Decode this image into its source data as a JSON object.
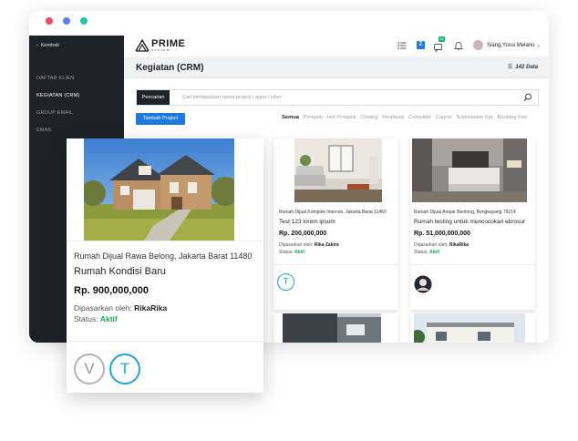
{
  "sidebar": {
    "back_label": "Kembali",
    "items": [
      {
        "label": "DAFTAR KLIEN"
      },
      {
        "label": "KEGIATAN (CRM)"
      },
      {
        "label": "GROUP EMAIL"
      },
      {
        "label": "EMAIL"
      }
    ]
  },
  "header": {
    "logo_text": "PRIME",
    "logo_sub": "SYSTEM",
    "badge_z": "Z",
    "badge_count": "61",
    "user_name": "Siang,Yossi Melano"
  },
  "page": {
    "title": "Kegiatan (CRM)",
    "data_count": "142 Data"
  },
  "search": {
    "button": "Pencarian",
    "placeholder": "Cari berdasarkan nama project / agen / klien"
  },
  "toolbar": {
    "add_button": "Tambah Project",
    "filters": [
      "Semua",
      "Prospek",
      "Hot Prospek",
      "Closing",
      "Finalisasi",
      "Complete",
      "Cancel",
      "Submission Kpr",
      "Booking Fee"
    ]
  },
  "cards": [
    {
      "location": "Rumah Dijual Rawa Belong, Jakarta Barat 11480",
      "title": "Rumah Kondisi Baru",
      "price": "Rp. 900,000,000",
      "by_label": "Dipasarkan oleh:",
      "by_name": "RikaRika",
      "status_label": "Status:",
      "status_value": "Aktif",
      "avatars": [
        "V",
        "T"
      ]
    },
    {
      "location": "Rumah Dijual Komplek Intercon, Jakarta Barat 11460",
      "title": "Test 123 lorem ipsum",
      "price": "Rp. 200,000,000",
      "by_label": "Dipasarkan oleh:",
      "by_name": "Rika Zakira",
      "status_label": "Status:",
      "status_value": "Aktif",
      "avatars": [
        "T"
      ]
    },
    {
      "location": "Rumah Dijual Ampar Bentong, Bengkayang 79214",
      "title": "Rumah testing untuk mencocokan ebrosur",
      "price": "Rp. 51,000,000,000",
      "by_label": "Dipasarkan oleh:",
      "by_name": "RikaRika",
      "status_label": "Status:",
      "status_value": "Aktif"
    }
  ],
  "colors": {
    "sidebar_bg": "#1e2126",
    "primary_blue": "#1f7ae0",
    "status_green": "#1aa84e",
    "avatar_teal": "#1ea5d9"
  }
}
